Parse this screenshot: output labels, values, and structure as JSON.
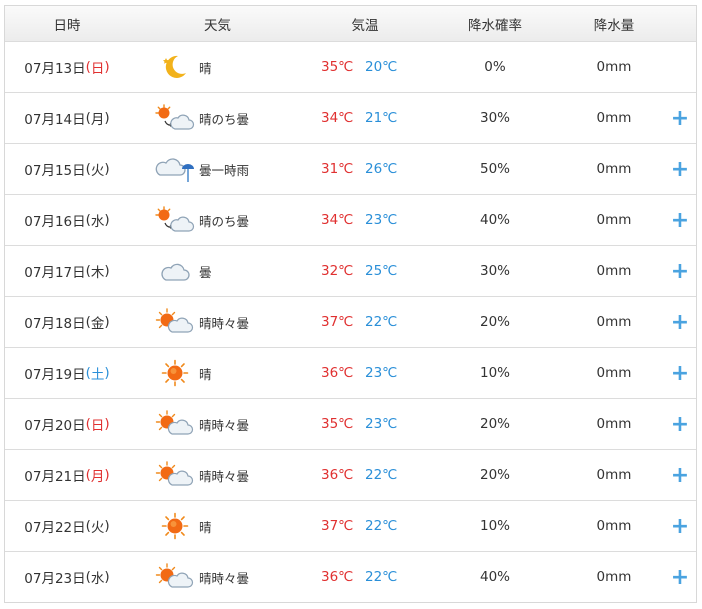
{
  "headers": {
    "date": "日時",
    "weather": "天気",
    "temperature": "気温",
    "precip_prob": "降水確率",
    "precip_amount": "降水量"
  },
  "colors": {
    "high_temp": "#e03030",
    "low_temp": "#2a8fd8",
    "plus": "#4aa3e0",
    "sunday": "#e03030",
    "saturday": "#2a8fd8"
  },
  "rows": [
    {
      "date": "07月13日",
      "open": "(",
      "dow": "日",
      "close": ")",
      "dow_type": "sun",
      "icon": "moon-icon",
      "weather": "晴",
      "high": "35℃",
      "low": "20℃",
      "pop": "0%",
      "rain": "0mm",
      "plus": ""
    },
    {
      "date": "07月14日",
      "open": "(",
      "dow": "月",
      "close": ")",
      "dow_type": "normal",
      "icon": "sun-then-cloud-icon",
      "weather": "晴のち曇",
      "high": "34℃",
      "low": "21℃",
      "pop": "30%",
      "rain": "0mm",
      "plus": "+"
    },
    {
      "date": "07月15日",
      "open": "(",
      "dow": "火",
      "close": ")",
      "dow_type": "normal",
      "icon": "cloud-rain-icon",
      "weather": "曇一時雨",
      "high": "31℃",
      "low": "26℃",
      "pop": "50%",
      "rain": "0mm",
      "plus": "+"
    },
    {
      "date": "07月16日",
      "open": "(",
      "dow": "水",
      "close": ")",
      "dow_type": "normal",
      "icon": "sun-then-cloud-icon",
      "weather": "晴のち曇",
      "high": "34℃",
      "low": "23℃",
      "pop": "40%",
      "rain": "0mm",
      "plus": "+"
    },
    {
      "date": "07月17日",
      "open": "(",
      "dow": "木",
      "close": ")",
      "dow_type": "normal",
      "icon": "cloud-icon",
      "weather": "曇",
      "high": "32℃",
      "low": "25℃",
      "pop": "30%",
      "rain": "0mm",
      "plus": "+"
    },
    {
      "date": "07月18日",
      "open": "(",
      "dow": "金",
      "close": ")",
      "dow_type": "normal",
      "icon": "sun-cloud-icon",
      "weather": "晴時々曇",
      "high": "37℃",
      "low": "22℃",
      "pop": "20%",
      "rain": "0mm",
      "plus": "+"
    },
    {
      "date": "07月19日",
      "open": "(",
      "dow": "土",
      "close": ")",
      "dow_type": "sat",
      "icon": "sun-icon",
      "weather": "晴",
      "high": "36℃",
      "low": "23℃",
      "pop": "10%",
      "rain": "0mm",
      "plus": "+"
    },
    {
      "date": "07月20日",
      "open": "(",
      "dow": "日",
      "close": ")",
      "dow_type": "sun",
      "icon": "sun-cloud-icon",
      "weather": "晴時々曇",
      "high": "35℃",
      "low": "23℃",
      "pop": "20%",
      "rain": "0mm",
      "plus": "+"
    },
    {
      "date": "07月21日",
      "open": "(",
      "dow": "月",
      "close": ")",
      "dow_type": "sun",
      "icon": "sun-cloud-icon",
      "weather": "晴時々曇",
      "high": "36℃",
      "low": "22℃",
      "pop": "20%",
      "rain": "0mm",
      "plus": "+"
    },
    {
      "date": "07月22日",
      "open": "(",
      "dow": "火",
      "close": ")",
      "dow_type": "normal",
      "icon": "sun-icon",
      "weather": "晴",
      "high": "37℃",
      "low": "22℃",
      "pop": "10%",
      "rain": "0mm",
      "plus": "+"
    },
    {
      "date": "07月23日",
      "open": "(",
      "dow": "水",
      "close": ")",
      "dow_type": "normal",
      "icon": "sun-cloud-icon",
      "weather": "晴時々曇",
      "high": "36℃",
      "low": "22℃",
      "pop": "40%",
      "rain": "0mm",
      "plus": "+"
    }
  ]
}
